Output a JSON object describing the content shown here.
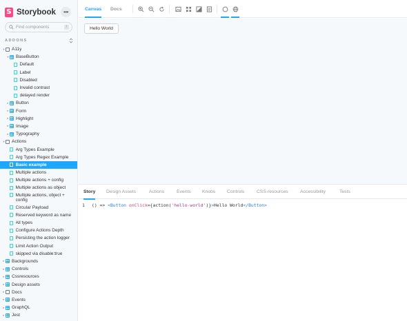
{
  "sidebar": {
    "brand": "Storybook",
    "search": {
      "placeholder": "Find components",
      "shortcut": "/"
    },
    "section_label": "ADDONS",
    "tree": [
      {
        "label": "A11y",
        "type": "folder",
        "depth": 0,
        "expanded": true
      },
      {
        "label": "BaseButton",
        "type": "component",
        "depth": 1,
        "expanded": true
      },
      {
        "label": "Default",
        "type": "story",
        "depth": 2
      },
      {
        "label": "Label",
        "type": "story",
        "depth": 2
      },
      {
        "label": "Disabled",
        "type": "story",
        "depth": 2
      },
      {
        "label": "Invalid contrast",
        "type": "story",
        "depth": 2
      },
      {
        "label": "delayed render",
        "type": "story",
        "depth": 2
      },
      {
        "label": "Button",
        "type": "component",
        "depth": 1,
        "expanded": false
      },
      {
        "label": "Form",
        "type": "component",
        "depth": 1,
        "expanded": false
      },
      {
        "label": "Highlight",
        "type": "component",
        "depth": 1,
        "expanded": false
      },
      {
        "label": "Image",
        "type": "component",
        "depth": 1,
        "expanded": false
      },
      {
        "label": "Typography",
        "type": "component",
        "depth": 1,
        "expanded": false
      },
      {
        "label": "Actions",
        "type": "folder",
        "depth": 0,
        "expanded": true
      },
      {
        "label": "Arg Types Example",
        "type": "story",
        "depth": 1
      },
      {
        "label": "Arg Types Regex Example",
        "type": "story",
        "depth": 1
      },
      {
        "label": "Basic example",
        "type": "story",
        "depth": 1,
        "selected": true
      },
      {
        "label": "Multiple actions",
        "type": "story",
        "depth": 1
      },
      {
        "label": "Multiple actions + config",
        "type": "story",
        "depth": 1
      },
      {
        "label": "Multiple actions as object",
        "type": "story",
        "depth": 1
      },
      {
        "label": "Multiple actions, object + config",
        "type": "story",
        "depth": 1,
        "wrap": true
      },
      {
        "label": "Circular Payload",
        "type": "story",
        "depth": 1
      },
      {
        "label": "Reserved keyword as name",
        "type": "story",
        "depth": 1
      },
      {
        "label": "All types",
        "type": "story",
        "depth": 1
      },
      {
        "label": "Configure Actions Depth",
        "type": "story",
        "depth": 1
      },
      {
        "label": "Persisting the action logger",
        "type": "story",
        "depth": 1
      },
      {
        "label": "Limit Action Output",
        "type": "story",
        "depth": 1
      },
      {
        "label": "skipped via disable:true",
        "type": "story",
        "depth": 1
      },
      {
        "label": "Backgrounds",
        "type": "component",
        "depth": 0,
        "expanded": false
      },
      {
        "label": "Controls",
        "type": "component",
        "depth": 0,
        "expanded": false
      },
      {
        "label": "Cssresources",
        "type": "component",
        "depth": 0,
        "expanded": false
      },
      {
        "label": "Design assets",
        "type": "component",
        "depth": 0,
        "expanded": false
      },
      {
        "label": "Docs",
        "type": "folder",
        "depth": 0,
        "expanded": false
      },
      {
        "label": "Events",
        "type": "component",
        "depth": 0,
        "expanded": false
      },
      {
        "label": "GraphQL",
        "type": "component",
        "depth": 0,
        "expanded": false
      },
      {
        "label": "Jest",
        "type": "component",
        "depth": 0,
        "expanded": false
      }
    ]
  },
  "toolbar": {
    "tabs": [
      {
        "label": "Canvas",
        "active": true
      },
      {
        "label": "Docs",
        "active": false
      }
    ],
    "tools": [
      "zoom-in-icon",
      "zoom-out-icon",
      "zoom-reset-icon",
      "image-icon",
      "grid-icon",
      "contrast-icon",
      "document-icon",
      "outline-icon",
      "globe-icon"
    ]
  },
  "canvas": {
    "button_label": "Hello World"
  },
  "panel": {
    "tabs": [
      {
        "label": "Story",
        "active": true
      },
      {
        "label": "Design Assets"
      },
      {
        "label": "Actions"
      },
      {
        "label": "Events"
      },
      {
        "label": "Knobs"
      },
      {
        "label": "Controls"
      },
      {
        "label": "CSS resources"
      },
      {
        "label": "Accessibility"
      },
      {
        "label": "Tests"
      }
    ],
    "code": {
      "line_number": "1",
      "prefix": "() => ",
      "open_tag": "<Button",
      "attr": " onClick",
      "eq": "=",
      "expr_open": "{action(",
      "string": "'hello-world'",
      "expr_close": ")}",
      "gt": ">",
      "text": "Hello World",
      "close_tag": "</Button>"
    }
  },
  "colors": {
    "accent": "#1ea7fd",
    "brand": "#ff4785",
    "story_icon": "#37d5d3",
    "sidebar_bg": "#f6f9fc"
  }
}
